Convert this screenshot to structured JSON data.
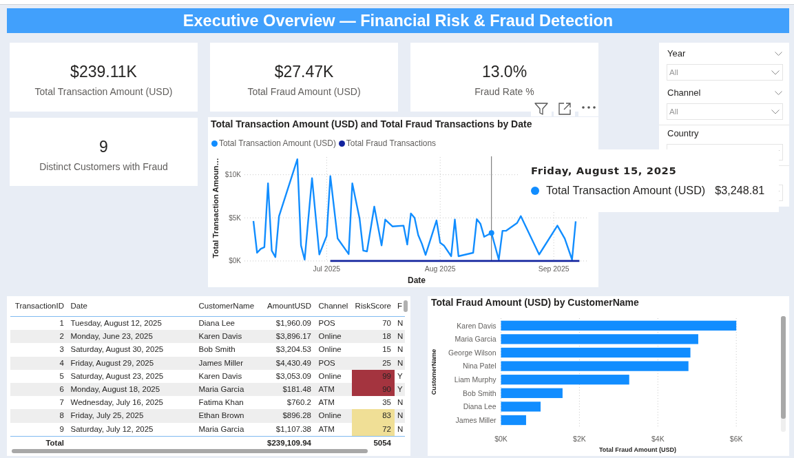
{
  "title": "Executive Overview — Financial Risk & Fraud Detection",
  "kpi_cards": [
    {
      "value": "$239.11K",
      "label": "Total Transaction Amount (USD)"
    },
    {
      "value": "$27.47K",
      "label": "Total Fraud Amount (USD)"
    },
    {
      "value": "13.0%",
      "label": "Fraud Rate %"
    },
    {
      "value": "9",
      "label": "Distinct Customers with Fraud"
    }
  ],
  "line_chart": {
    "chart_data": {
      "type": "line",
      "title": "Total Transaction Amount (USD) and Total Fraud Transactions by Date",
      "xlabel": "Date",
      "ylabel": "Total Transaction Amoun…",
      "legend": "top",
      "grid": true,
      "x": [
        "2025-06-11",
        "2025-06-12",
        "2025-06-13",
        "2025-06-14",
        "2025-06-15",
        "2025-06-16",
        "2025-06-17",
        "2025-06-18",
        "2025-06-23",
        "2025-06-24",
        "2025-06-25",
        "2025-06-27",
        "2025-06-29",
        "2025-07-01",
        "2025-07-02",
        "2025-07-04",
        "2025-07-07",
        "2025-07-08",
        "2025-07-10",
        "2025-07-11",
        "2025-07-12",
        "2025-07-14",
        "2025-07-16",
        "2025-07-17",
        "2025-07-19",
        "2025-07-22",
        "2025-07-23",
        "2025-07-24",
        "2025-07-25",
        "2025-07-26",
        "2025-07-27",
        "2025-07-28",
        "2025-07-31",
        "2025-08-01",
        "2025-08-02",
        "2025-08-04",
        "2025-08-05",
        "2025-08-06",
        "2025-08-10",
        "2025-08-11",
        "2025-08-12",
        "2025-08-13",
        "2025-08-15",
        "2025-08-17",
        "2025-08-18",
        "2025-08-19",
        "2025-08-22",
        "2025-08-23",
        "2025-08-24",
        "2025-08-28",
        "2025-08-30",
        "2025-09-02",
        "2025-09-03",
        "2025-09-04",
        "2025-09-06",
        "2025-09-07",
        "2025-09-08"
      ],
      "series": [
        {
          "name": "Total Transaction Amount (USD)",
          "color": "#118dff",
          "values": [
            4640,
            950,
            1400,
            1600,
            9000,
            1200,
            450,
            5200,
            11800,
            1800,
            150,
            9600,
            750,
            2900,
            9850,
            2600,
            800,
            9000,
            4900,
            1200,
            1110,
            6300,
            1800,
            4800,
            4000,
            4100,
            1900,
            5500,
            5000,
            3000,
            2000,
            700,
            4700,
            2100,
            1800,
            550,
            4800,
            550,
            950,
            4850,
            4300,
            2800,
            3250,
            150,
            3500,
            3500,
            4400,
            5200,
            null,
            750,
            null,
            4100,
            null,
            2600,
            150,
            4600,
            null
          ]
        },
        {
          "name": "Total Fraud Transactions",
          "color": "#12239e",
          "values": [
            null,
            null,
            null,
            null,
            null,
            null,
            null,
            null,
            null,
            null,
            null,
            null,
            null,
            null,
            0,
            0,
            0,
            0,
            0,
            0,
            0,
            0,
            0,
            0,
            0,
            0,
            0,
            0,
            0,
            0,
            0,
            0,
            0,
            0,
            0,
            0,
            0,
            0,
            0,
            0,
            0,
            0,
            0,
            0,
            0,
            0,
            0,
            0,
            0,
            0,
            0,
            0,
            0,
            0,
            0,
            0,
            0
          ]
        }
      ],
      "xlim": [
        "2025-06-08",
        "2025-09-10"
      ],
      "ylim": [
        0,
        12000
      ],
      "xticks": [
        {
          "value": "2025-07-01",
          "label": "Jul 2025"
        },
        {
          "value": "2025-08-01",
          "label": "Aug 2025"
        },
        {
          "value": "2025-09-01",
          "label": "Sep 2025"
        }
      ],
      "yticks": [
        {
          "value": 0,
          "label": "$0K"
        },
        {
          "value": 5000,
          "label": "$5K"
        },
        {
          "value": 10000,
          "label": "$10K"
        }
      ],
      "ref_lines": [
        {
          "axis": "x",
          "value": "2025-08-15"
        }
      ]
    },
    "tooltip": {
      "title": "Friday, August 15, 2025",
      "series": "Total Transaction Amount (USD)",
      "value": "$3,248.81"
    }
  },
  "filters": [
    {
      "title": "Year",
      "placeholder": "All",
      "collapsible": true
    },
    {
      "title": "Channel",
      "placeholder": "All",
      "collapsible": true
    },
    {
      "title": "Country",
      "collapsible": false
    }
  ],
  "table": {
    "columns": [
      "TransactionID",
      "Date",
      "CustomerName",
      "AmountUSD",
      "Channel",
      "RiskScore",
      "F"
    ],
    "rows": [
      {
        "transaction_id": "1",
        "date": "Tuesday, August 12, 2025",
        "customer_name": "Diana Lee",
        "amount_usd": "$1,960.09",
        "channel": "POS",
        "risk_score": "70",
        "column_7": "N"
      },
      {
        "transaction_id": "2",
        "date": "Monday, June 23, 2025",
        "customer_name": "Karen Davis",
        "amount_usd": "$3,896.17",
        "channel": "Online",
        "risk_score": "18",
        "column_7": "N"
      },
      {
        "transaction_id": "3",
        "date": "Saturday, August 30, 2025",
        "customer_name": "Bob Smith",
        "amount_usd": "$3,204.53",
        "channel": "Online",
        "risk_score": "15",
        "column_7": "N"
      },
      {
        "transaction_id": "4",
        "date": "Friday, August 29, 2025",
        "customer_name": "James Miller",
        "amount_usd": "$4,430.49",
        "channel": "POS",
        "risk_score": "25",
        "column_7": "N"
      },
      {
        "transaction_id": "5",
        "date": "Saturday, August 23, 2025",
        "customer_name": "Karen Davis",
        "amount_usd": "$3,053.09",
        "channel": "Online",
        "risk_score": "99",
        "column_7": "Y",
        "color": "#a4343f"
      },
      {
        "transaction_id": "6",
        "date": "Monday, August 18, 2025",
        "customer_name": "Maria Garcia",
        "amount_usd": "$181.48",
        "channel": "ATM",
        "risk_score": "90",
        "column_7": "Y",
        "color": "#a4343f"
      },
      {
        "transaction_id": "7",
        "date": "Wednesday, July 16, 2025",
        "customer_name": "Fatima Khan",
        "amount_usd": "$760.2",
        "channel": "ATM",
        "risk_score": "35",
        "column_7": "N"
      },
      {
        "transaction_id": "8",
        "date": "Friday, July 25, 2025",
        "customer_name": "Ethan Brown",
        "amount_usd": "$896.28",
        "channel": "Online",
        "risk_score": "83",
        "column_7": "N",
        "color": "#f0df96"
      },
      {
        "transaction_id": "9",
        "date": "Saturday, July 12, 2025",
        "customer_name": "Maria Garcia",
        "amount_usd": "$1,107.38",
        "channel": "ATM",
        "risk_score": "72",
        "column_7": "N",
        "color": "#f0df96"
      }
    ],
    "total": {
      "label": "Total",
      "amount_usd": "$239,109.94",
      "risk_score": "5054"
    }
  },
  "bar_chart": {
    "chart_data": {
      "type": "bar",
      "orientation": "horizontal",
      "title": "Total Fraud Amount (USD) by CustomerName",
      "xlabel": "Total Fraud Amount (USD)",
      "ylabel": "CustomerName",
      "grid": true,
      "categories": [
        "Karen Davis",
        "Maria Garcia",
        "George Wilson",
        "Nina Patel",
        "Liam Murphy",
        "Bob Smith",
        "Diana Lee",
        "James Miller"
      ],
      "values": [
        6000,
        5030,
        4830,
        4780,
        3270,
        1570,
        1010,
        640
      ],
      "xlim": [
        0,
        6000
      ],
      "xticks": [
        {
          "value": 0,
          "label": "$0K"
        },
        {
          "value": 2000,
          "label": "$2K"
        },
        {
          "value": 4000,
          "label": "$4K"
        },
        {
          "value": 6000,
          "label": "$6K"
        }
      ]
    }
  }
}
